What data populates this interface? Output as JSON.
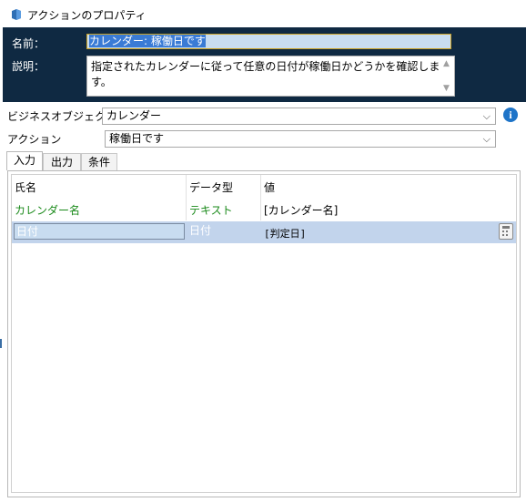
{
  "window": {
    "title": "アクションのプロパティ",
    "icon": "action-properties-icon"
  },
  "header": {
    "name_label": "名前：",
    "name_value": "カレンダー: 稼働日です",
    "description_label": "説明：",
    "description_value": "指定されたカレンダーに従って任意の日付が稼働日かどうかを確認します。"
  },
  "form": {
    "business_object_label": "ビジネスオブジェクト",
    "business_object_value": "カレンダー",
    "action_label": "アクション",
    "action_value": "稼働日です",
    "info_icon": "info-icon"
  },
  "tabs": [
    {
      "label": "入力",
      "active": true
    },
    {
      "label": "出力",
      "active": false
    },
    {
      "label": "条件",
      "active": false
    }
  ],
  "grid": {
    "columns": [
      "氏名",
      "データ型",
      "値"
    ],
    "rows": [
      {
        "name": "カレンダー名",
        "type": "テキスト",
        "value": "[カレンダー名]",
        "selected": false
      },
      {
        "name": "日付",
        "type": "日付",
        "value": "[判定日]",
        "selected": true
      }
    ],
    "calculator_icon": "calculator-icon"
  },
  "colors": {
    "header_bg": "#0f2942",
    "green_text": "#1a8a1a",
    "selection": "#c2d4ec",
    "info": "#1e74c8"
  }
}
